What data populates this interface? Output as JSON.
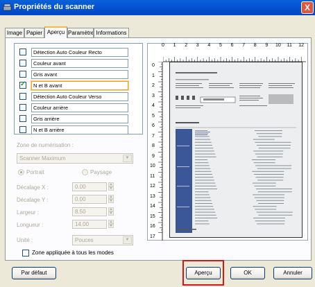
{
  "window": {
    "title": "Propriétés du scanner",
    "close_glyph": "X"
  },
  "tabs": [
    {
      "label": "Image",
      "active": false
    },
    {
      "label": "Papier",
      "active": false
    },
    {
      "label": "Aperçu",
      "active": true
    },
    {
      "label": "Paramètre",
      "active": false
    },
    {
      "label": "Informations",
      "active": false
    }
  ],
  "modes": [
    {
      "label": "Détection Auto Couleur Recto",
      "checked": false
    },
    {
      "label": "Couleur avant",
      "checked": false
    },
    {
      "label": "Gris avant",
      "checked": false
    },
    {
      "label": "N et B avant",
      "checked": true
    },
    {
      "label": "Détection Auto Couleur Verso",
      "checked": false
    },
    {
      "label": "Couleur arrière",
      "checked": false
    },
    {
      "label": "Gris arrière",
      "checked": false
    },
    {
      "label": "N et B arrière",
      "checked": false
    }
  ],
  "scan_area": {
    "label": "Zone de numérisation :",
    "value": "Scanner Maximum",
    "portrait_label": "Portrait",
    "landscape_label": "Paysage",
    "portrait_selected": true
  },
  "fields": {
    "offset_x": {
      "label": "Décalage X :",
      "value": "0.00"
    },
    "offset_y": {
      "label": "Décalage Y :",
      "value": "0.00"
    },
    "width": {
      "label": "Largeur :",
      "value": "8.50"
    },
    "length": {
      "label": "Longueur :",
      "value": "14.00"
    },
    "unit": {
      "label": "Unité :",
      "value": "Pouces"
    }
  },
  "apply_all": {
    "label": "Zone appliquée à tous les modes",
    "checked": false
  },
  "ruler": {
    "horizontal": [
      "0",
      "1",
      "2",
      "3",
      "4",
      "5",
      "6",
      "7",
      "8",
      "9",
      "10",
      "11",
      "12"
    ],
    "vertical": [
      "0",
      "1",
      "2",
      "3",
      "4",
      "5",
      "6",
      "7",
      "8",
      "9",
      "10",
      "11",
      "12",
      "13",
      "14",
      "15",
      "16",
      "17"
    ]
  },
  "buttons": {
    "default": "Par défaut",
    "preview": "Aperçu",
    "ok": "OK",
    "cancel": "Annuler"
  },
  "colors": {
    "titlebar": "#0454d4",
    "highlight": "#d71515",
    "doc_band": "#3b5797"
  }
}
